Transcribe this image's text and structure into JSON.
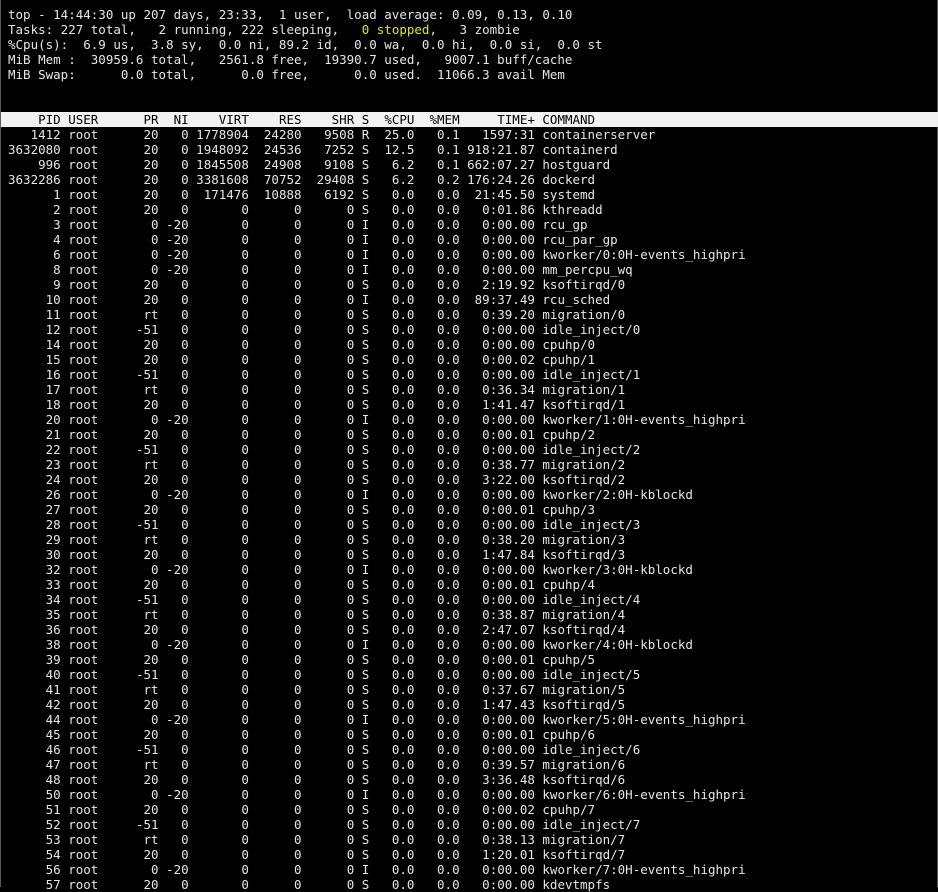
{
  "summary": {
    "line1": "top - 14:44:30 up 207 days, 23:33,  1 user,  load average: 0.09, 0.13, 0.10",
    "tasks_pre": "Tasks: 227 total,   2 running, 222 sleeping,   ",
    "tasks_stopped": "0 stopped",
    "tasks_post": ",   3 zombie",
    "cpu": "%Cpu(s):  6.9 us,  3.8 sy,  0.0 ni, 89.2 id,  0.0 wa,  0.0 hi,  0.0 si,  0.0 st",
    "mem": "MiB Mem :  30959.6 total,   2561.8 free,  19390.7 used,   9007.1 buff/cache",
    "swap": "MiB Swap:      0.0 total,      0.0 free,      0.0 used.  11066.3 avail Mem"
  },
  "colors": {
    "background": "#000000",
    "text": "#e6e6e6",
    "header_bg": "#f2f2f2",
    "header_text": "#000000",
    "highlight": "#e6e600"
  },
  "table": {
    "columns": [
      "PID",
      "USER",
      "PR",
      "NI",
      "VIRT",
      "RES",
      "SHR",
      "S",
      "%CPU",
      "%MEM",
      "TIME+",
      "COMMAND"
    ],
    "rows": [
      [
        "1412",
        "root",
        "20",
        "0",
        "1778904",
        "24280",
        "9508",
        "R",
        "25.0",
        "0.1",
        "1597:31",
        "containerserver"
      ],
      [
        "3632080",
        "root",
        "20",
        "0",
        "1948092",
        "24536",
        "7252",
        "S",
        "12.5",
        "0.1",
        "918:21.87",
        "containerd"
      ],
      [
        "996",
        "root",
        "20",
        "0",
        "1845508",
        "24908",
        "9108",
        "S",
        "6.2",
        "0.1",
        "662:07.27",
        "hostguard"
      ],
      [
        "3632286",
        "root",
        "20",
        "0",
        "3381608",
        "70752",
        "29408",
        "S",
        "6.2",
        "0.2",
        "176:24.26",
        "dockerd"
      ],
      [
        "1",
        "root",
        "20",
        "0",
        "171476",
        "10888",
        "6192",
        "S",
        "0.0",
        "0.0",
        "21:45.50",
        "systemd"
      ],
      [
        "2",
        "root",
        "20",
        "0",
        "0",
        "0",
        "0",
        "S",
        "0.0",
        "0.0",
        "0:01.86",
        "kthreadd"
      ],
      [
        "3",
        "root",
        "0",
        "-20",
        "0",
        "0",
        "0",
        "I",
        "0.0",
        "0.0",
        "0:00.00",
        "rcu_gp"
      ],
      [
        "4",
        "root",
        "0",
        "-20",
        "0",
        "0",
        "0",
        "I",
        "0.0",
        "0.0",
        "0:00.00",
        "rcu_par_gp"
      ],
      [
        "6",
        "root",
        "0",
        "-20",
        "0",
        "0",
        "0",
        "I",
        "0.0",
        "0.0",
        "0:00.00",
        "kworker/0:0H-events_highpri"
      ],
      [
        "8",
        "root",
        "0",
        "-20",
        "0",
        "0",
        "0",
        "I",
        "0.0",
        "0.0",
        "0:00.00",
        "mm_percpu_wq"
      ],
      [
        "9",
        "root",
        "20",
        "0",
        "0",
        "0",
        "0",
        "S",
        "0.0",
        "0.0",
        "2:19.92",
        "ksoftirqd/0"
      ],
      [
        "10",
        "root",
        "20",
        "0",
        "0",
        "0",
        "0",
        "I",
        "0.0",
        "0.0",
        "89:37.49",
        "rcu_sched"
      ],
      [
        "11",
        "root",
        "rt",
        "0",
        "0",
        "0",
        "0",
        "S",
        "0.0",
        "0.0",
        "0:39.20",
        "migration/0"
      ],
      [
        "12",
        "root",
        "-51",
        "0",
        "0",
        "0",
        "0",
        "S",
        "0.0",
        "0.0",
        "0:00.00",
        "idle_inject/0"
      ],
      [
        "14",
        "root",
        "20",
        "0",
        "0",
        "0",
        "0",
        "S",
        "0.0",
        "0.0",
        "0:00.00",
        "cpuhp/0"
      ],
      [
        "15",
        "root",
        "20",
        "0",
        "0",
        "0",
        "0",
        "S",
        "0.0",
        "0.0",
        "0:00.02",
        "cpuhp/1"
      ],
      [
        "16",
        "root",
        "-51",
        "0",
        "0",
        "0",
        "0",
        "S",
        "0.0",
        "0.0",
        "0:00.00",
        "idle_inject/1"
      ],
      [
        "17",
        "root",
        "rt",
        "0",
        "0",
        "0",
        "0",
        "S",
        "0.0",
        "0.0",
        "0:36.34",
        "migration/1"
      ],
      [
        "18",
        "root",
        "20",
        "0",
        "0",
        "0",
        "0",
        "S",
        "0.0",
        "0.0",
        "1:41.47",
        "ksoftirqd/1"
      ],
      [
        "20",
        "root",
        "0",
        "-20",
        "0",
        "0",
        "0",
        "I",
        "0.0",
        "0.0",
        "0:00.00",
        "kworker/1:0H-events_highpri"
      ],
      [
        "21",
        "root",
        "20",
        "0",
        "0",
        "0",
        "0",
        "S",
        "0.0",
        "0.0",
        "0:00.01",
        "cpuhp/2"
      ],
      [
        "22",
        "root",
        "-51",
        "0",
        "0",
        "0",
        "0",
        "S",
        "0.0",
        "0.0",
        "0:00.00",
        "idle_inject/2"
      ],
      [
        "23",
        "root",
        "rt",
        "0",
        "0",
        "0",
        "0",
        "S",
        "0.0",
        "0.0",
        "0:38.77",
        "migration/2"
      ],
      [
        "24",
        "root",
        "20",
        "0",
        "0",
        "0",
        "0",
        "S",
        "0.0",
        "0.0",
        "3:22.00",
        "ksoftirqd/2"
      ],
      [
        "26",
        "root",
        "0",
        "-20",
        "0",
        "0",
        "0",
        "I",
        "0.0",
        "0.0",
        "0:00.00",
        "kworker/2:0H-kblockd"
      ],
      [
        "27",
        "root",
        "20",
        "0",
        "0",
        "0",
        "0",
        "S",
        "0.0",
        "0.0",
        "0:00.01",
        "cpuhp/3"
      ],
      [
        "28",
        "root",
        "-51",
        "0",
        "0",
        "0",
        "0",
        "S",
        "0.0",
        "0.0",
        "0:00.00",
        "idle_inject/3"
      ],
      [
        "29",
        "root",
        "rt",
        "0",
        "0",
        "0",
        "0",
        "S",
        "0.0",
        "0.0",
        "0:38.20",
        "migration/3"
      ],
      [
        "30",
        "root",
        "20",
        "0",
        "0",
        "0",
        "0",
        "S",
        "0.0",
        "0.0",
        "1:47.84",
        "ksoftirqd/3"
      ],
      [
        "32",
        "root",
        "0",
        "-20",
        "0",
        "0",
        "0",
        "I",
        "0.0",
        "0.0",
        "0:00.00",
        "kworker/3:0H-kblockd"
      ],
      [
        "33",
        "root",
        "20",
        "0",
        "0",
        "0",
        "0",
        "S",
        "0.0",
        "0.0",
        "0:00.01",
        "cpuhp/4"
      ],
      [
        "34",
        "root",
        "-51",
        "0",
        "0",
        "0",
        "0",
        "S",
        "0.0",
        "0.0",
        "0:00.00",
        "idle_inject/4"
      ],
      [
        "35",
        "root",
        "rt",
        "0",
        "0",
        "0",
        "0",
        "S",
        "0.0",
        "0.0",
        "0:38.87",
        "migration/4"
      ],
      [
        "36",
        "root",
        "20",
        "0",
        "0",
        "0",
        "0",
        "S",
        "0.0",
        "0.0",
        "2:47.07",
        "ksoftirqd/4"
      ],
      [
        "38",
        "root",
        "0",
        "-20",
        "0",
        "0",
        "0",
        "I",
        "0.0",
        "0.0",
        "0:00.00",
        "kworker/4:0H-kblockd"
      ],
      [
        "39",
        "root",
        "20",
        "0",
        "0",
        "0",
        "0",
        "S",
        "0.0",
        "0.0",
        "0:00.01",
        "cpuhp/5"
      ],
      [
        "40",
        "root",
        "-51",
        "0",
        "0",
        "0",
        "0",
        "S",
        "0.0",
        "0.0",
        "0:00.00",
        "idle_inject/5"
      ],
      [
        "41",
        "root",
        "rt",
        "0",
        "0",
        "0",
        "0",
        "S",
        "0.0",
        "0.0",
        "0:37.67",
        "migration/5"
      ],
      [
        "42",
        "root",
        "20",
        "0",
        "0",
        "0",
        "0",
        "S",
        "0.0",
        "0.0",
        "1:47.43",
        "ksoftirqd/5"
      ],
      [
        "44",
        "root",
        "0",
        "-20",
        "0",
        "0",
        "0",
        "I",
        "0.0",
        "0.0",
        "0:00.00",
        "kworker/5:0H-events_highpri"
      ],
      [
        "45",
        "root",
        "20",
        "0",
        "0",
        "0",
        "0",
        "S",
        "0.0",
        "0.0",
        "0:00.01",
        "cpuhp/6"
      ],
      [
        "46",
        "root",
        "-51",
        "0",
        "0",
        "0",
        "0",
        "S",
        "0.0",
        "0.0",
        "0:00.00",
        "idle_inject/6"
      ],
      [
        "47",
        "root",
        "rt",
        "0",
        "0",
        "0",
        "0",
        "S",
        "0.0",
        "0.0",
        "0:39.57",
        "migration/6"
      ],
      [
        "48",
        "root",
        "20",
        "0",
        "0",
        "0",
        "0",
        "S",
        "0.0",
        "0.0",
        "3:36.48",
        "ksoftirqd/6"
      ],
      [
        "50",
        "root",
        "0",
        "-20",
        "0",
        "0",
        "0",
        "I",
        "0.0",
        "0.0",
        "0:00.00",
        "kworker/6:0H-events_highpri"
      ],
      [
        "51",
        "root",
        "20",
        "0",
        "0",
        "0",
        "0",
        "S",
        "0.0",
        "0.0",
        "0:00.02",
        "cpuhp/7"
      ],
      [
        "52",
        "root",
        "-51",
        "0",
        "0",
        "0",
        "0",
        "S",
        "0.0",
        "0.0",
        "0:00.00",
        "idle_inject/7"
      ],
      [
        "53",
        "root",
        "rt",
        "0",
        "0",
        "0",
        "0",
        "S",
        "0.0",
        "0.0",
        "0:38.13",
        "migration/7"
      ],
      [
        "54",
        "root",
        "20",
        "0",
        "0",
        "0",
        "0",
        "S",
        "0.0",
        "0.0",
        "1:20.01",
        "ksoftirqd/7"
      ],
      [
        "56",
        "root",
        "0",
        "-20",
        "0",
        "0",
        "0",
        "I",
        "0.0",
        "0.0",
        "0:00.00",
        "kworker/7:0H-events_highpri"
      ],
      [
        "57",
        "root",
        "20",
        "0",
        "0",
        "0",
        "0",
        "S",
        "0.0",
        "0.0",
        "0:00.00",
        "kdevtmpfs"
      ]
    ]
  }
}
